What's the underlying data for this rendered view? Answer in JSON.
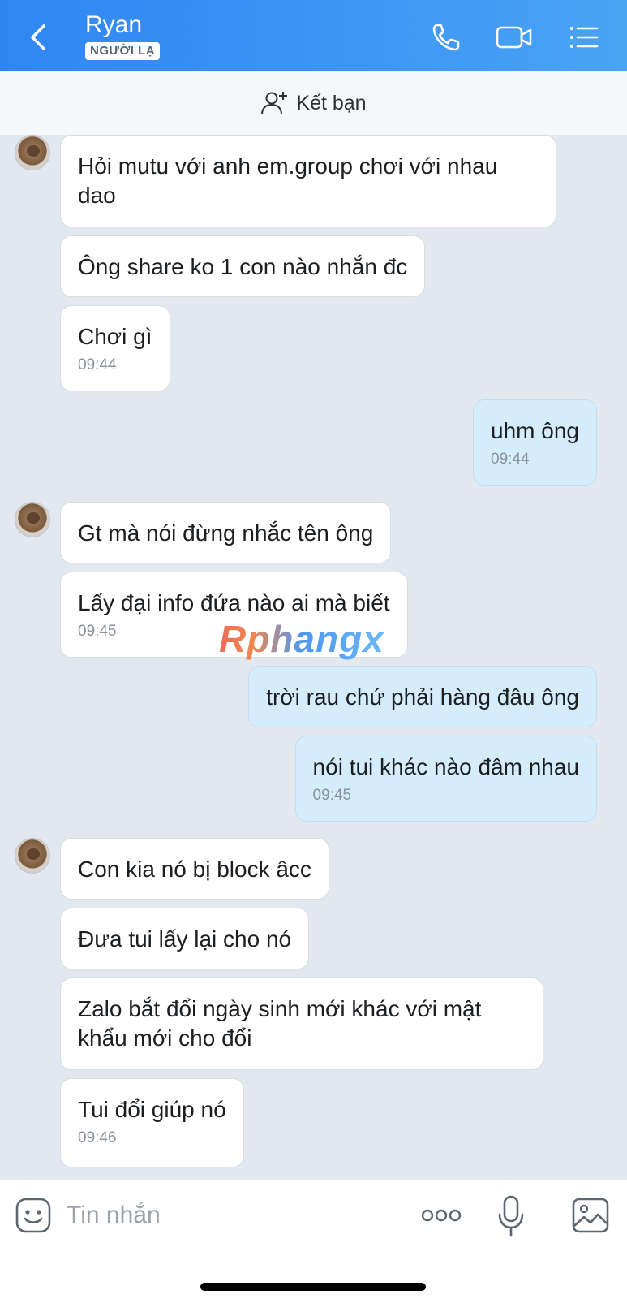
{
  "header": {
    "contact_name": "Ryan",
    "badge": "NGƯỜI LẠ"
  },
  "friend_bar": {
    "label": "Kết bạn"
  },
  "messages": [
    {
      "dir": "in",
      "text": "Hỏi mutu với anh em.group chơi với nhau dao",
      "time": ""
    },
    {
      "dir": "in",
      "text": "Ông share ko 1 con nào nhắn đc",
      "time": ""
    },
    {
      "dir": "in",
      "text": "Chơi gì",
      "time": "09:44"
    },
    {
      "dir": "out",
      "text": "uhm ông",
      "time": "09:44"
    },
    {
      "dir": "in",
      "text": "Gt mà nói đừng nhắc tên ông",
      "time": ""
    },
    {
      "dir": "in",
      "text": "Lấy đại info đứa nào ai mà biết",
      "time": "09:45"
    },
    {
      "dir": "out",
      "text": "trời rau chứ phải hàng đâu ông",
      "time": ""
    },
    {
      "dir": "out",
      "text": "nói tui khác nào đâm nhau",
      "time": "09:45"
    },
    {
      "dir": "in",
      "text": "Con kia nó bị block âcc",
      "time": ""
    },
    {
      "dir": "in",
      "text": "Đưa tui lấy lại cho nó",
      "time": ""
    },
    {
      "dir": "in",
      "text": "Zalo bắt đổi ngày sinh mới khác với mật khẩu mới cho đổi",
      "time": ""
    },
    {
      "dir": "in",
      "text": "Tui đổi giúp nó",
      "time": "09:46"
    }
  ],
  "watermark": "Rphangx",
  "input": {
    "placeholder": "Tin nhắn"
  },
  "colors": {
    "header_gradient_start": "#2f86f2",
    "header_gradient_end": "#4aa4f4",
    "chat_bg": "#e2e8f0",
    "incoming_bubble": "#ffffff",
    "outgoing_bubble": "#d5ecfc"
  },
  "icons": {
    "back": "chevron-left-icon",
    "call": "phone-icon",
    "video": "video-camera-icon",
    "menu": "list-menu-icon",
    "add_friend": "add-user-icon",
    "sticker": "smiley-sticker-icon",
    "more": "ellipsis-icon",
    "mic": "microphone-icon",
    "image": "image-icon"
  }
}
